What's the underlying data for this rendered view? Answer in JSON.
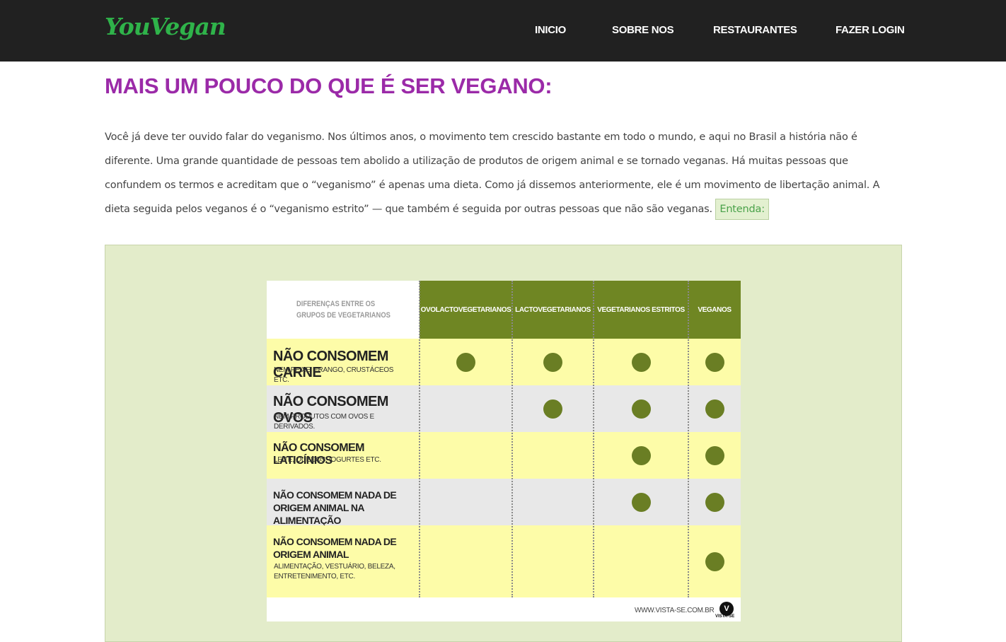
{
  "navbar": {
    "logo": "YouVegan",
    "items": [
      "INICIO",
      "SOBRE NOS",
      "RESTAURANTES",
      "FAZER LOGIN"
    ]
  },
  "page": {
    "title": "MAIS UM POUCO DO QUE É SER VEGANO:",
    "intro": "Você já deve ter ouvido falar do veganismo. Nos últimos anos, o movimento tem crescido bastante em todo o mundo, e aqui no Brasil a história não é diferente. Uma grande quantidade de pessoas tem abolido a utilização de produtos de origem animal e se tornado veganas. Há muitas pessoas que confundem os termos e acreditam que o “veganismo” é apenas uma dieta. Como já dissemos anteriormente, ele é um movimento de libertação animal. A dieta seguida pelos veganos é o “veganismo estrito” — que também é seguida por outras pessoas que não são veganas.",
    "entenda_label": "Entenda:"
  },
  "infographic": {
    "corner_label": "DIFERENÇAS ENTRE OS GRUPOS DE VEGETARIANOS",
    "columns": [
      "OVOLACTOVEGETARIANOS",
      "LACTOVEGETARIANOS",
      "VEGETARIANOS ESTRITOS",
      "VEGANOS"
    ],
    "rows": [
      {
        "title": "NÃO CONSOMEM CARNE",
        "subtitle": "NEM PEIXE, FRANGO, CRUSTÁCEOS ETC."
      },
      {
        "title": "NÃO CONSOMEM OVOS",
        "subtitle": "NEM PRODUTOS COM OVOS E DERIVADOS."
      },
      {
        "title": "NÃO CONSOMEM LATICÍNIOS",
        "subtitle": "LEITE, QUEIJOS, IOGURTES ETC."
      },
      {
        "title": "NÃO CONSOMEM NADA DE ORIGEM ANIMAL NA ALIMENTAÇÃO",
        "subtitle": ""
      },
      {
        "title": "NÃO CONSOMEM NADA DE ORIGEM ANIMAL",
        "subtitle": "ALIMENTAÇÃO, VESTUÁRIO, BELEZA, ENTRETENIMENTO, ETC."
      }
    ],
    "matrix": [
      [
        true,
        true,
        true,
        true
      ],
      [
        false,
        true,
        true,
        true
      ],
      [
        false,
        false,
        true,
        true
      ],
      [
        false,
        false,
        true,
        true
      ],
      [
        false,
        false,
        false,
        true
      ]
    ],
    "footer_url": "WWW.VISTA-SE.COM.BR",
    "footer_logo_text": "VISTA-SE",
    "footer_logo_letter": "V",
    "colors": {
      "header_green": "#6f8623",
      "dot_green": "#6a7e24",
      "row_yellow": "#fdfca8",
      "row_grey": "#e8e8e8"
    }
  }
}
